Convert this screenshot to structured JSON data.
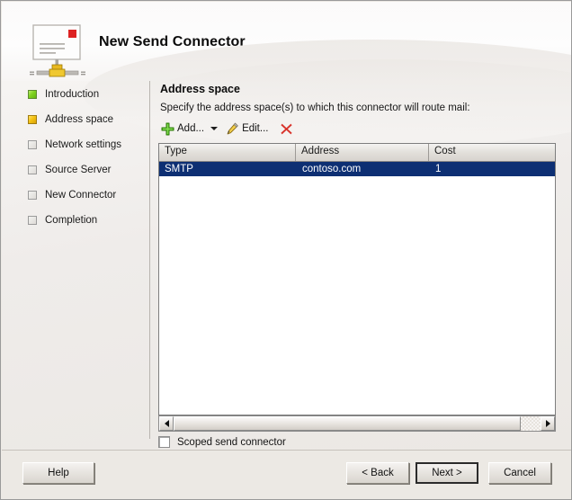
{
  "window": {
    "title": "New Send Connector",
    "icon": "send-connector-icon"
  },
  "sidebar": {
    "items": [
      {
        "label": "Introduction",
        "state": "done"
      },
      {
        "label": "Address space",
        "state": "current"
      },
      {
        "label": "Network settings",
        "state": "pending"
      },
      {
        "label": "Source Server",
        "state": "pending"
      },
      {
        "label": "New Connector",
        "state": "pending"
      },
      {
        "label": "Completion",
        "state": "pending"
      }
    ]
  },
  "content": {
    "section_title": "Address space",
    "instruction": "Specify the address space(s) to which this connector will route mail:",
    "toolbar": {
      "add_label": "Add...",
      "add_icon": "green-plus-icon",
      "add_dropdown_icon": "chevron-down-icon",
      "edit_label": "Edit...",
      "edit_icon": "pencil-icon",
      "delete_icon": "red-x-icon"
    },
    "table": {
      "columns": [
        "Type",
        "Address",
        "Cost"
      ],
      "rows": [
        {
          "type": "SMTP",
          "address": "contoso.com",
          "cost": "1",
          "selected": true
        }
      ]
    },
    "scrollbar": {
      "left_arrow_icon": "triangle-left-icon",
      "right_arrow_icon": "triangle-right-icon"
    },
    "scoped": {
      "label": "Scoped send connector",
      "checked": false
    }
  },
  "footer": {
    "help_label": "Help",
    "back_label": "< Back",
    "next_label": "Next >",
    "cancel_label": "Cancel"
  },
  "colors": {
    "selection_blue": "#0d2f73",
    "step_done_green": "#7fd21e",
    "step_current_gold": "#f5c313",
    "dialog_face": "#ece9e4"
  }
}
